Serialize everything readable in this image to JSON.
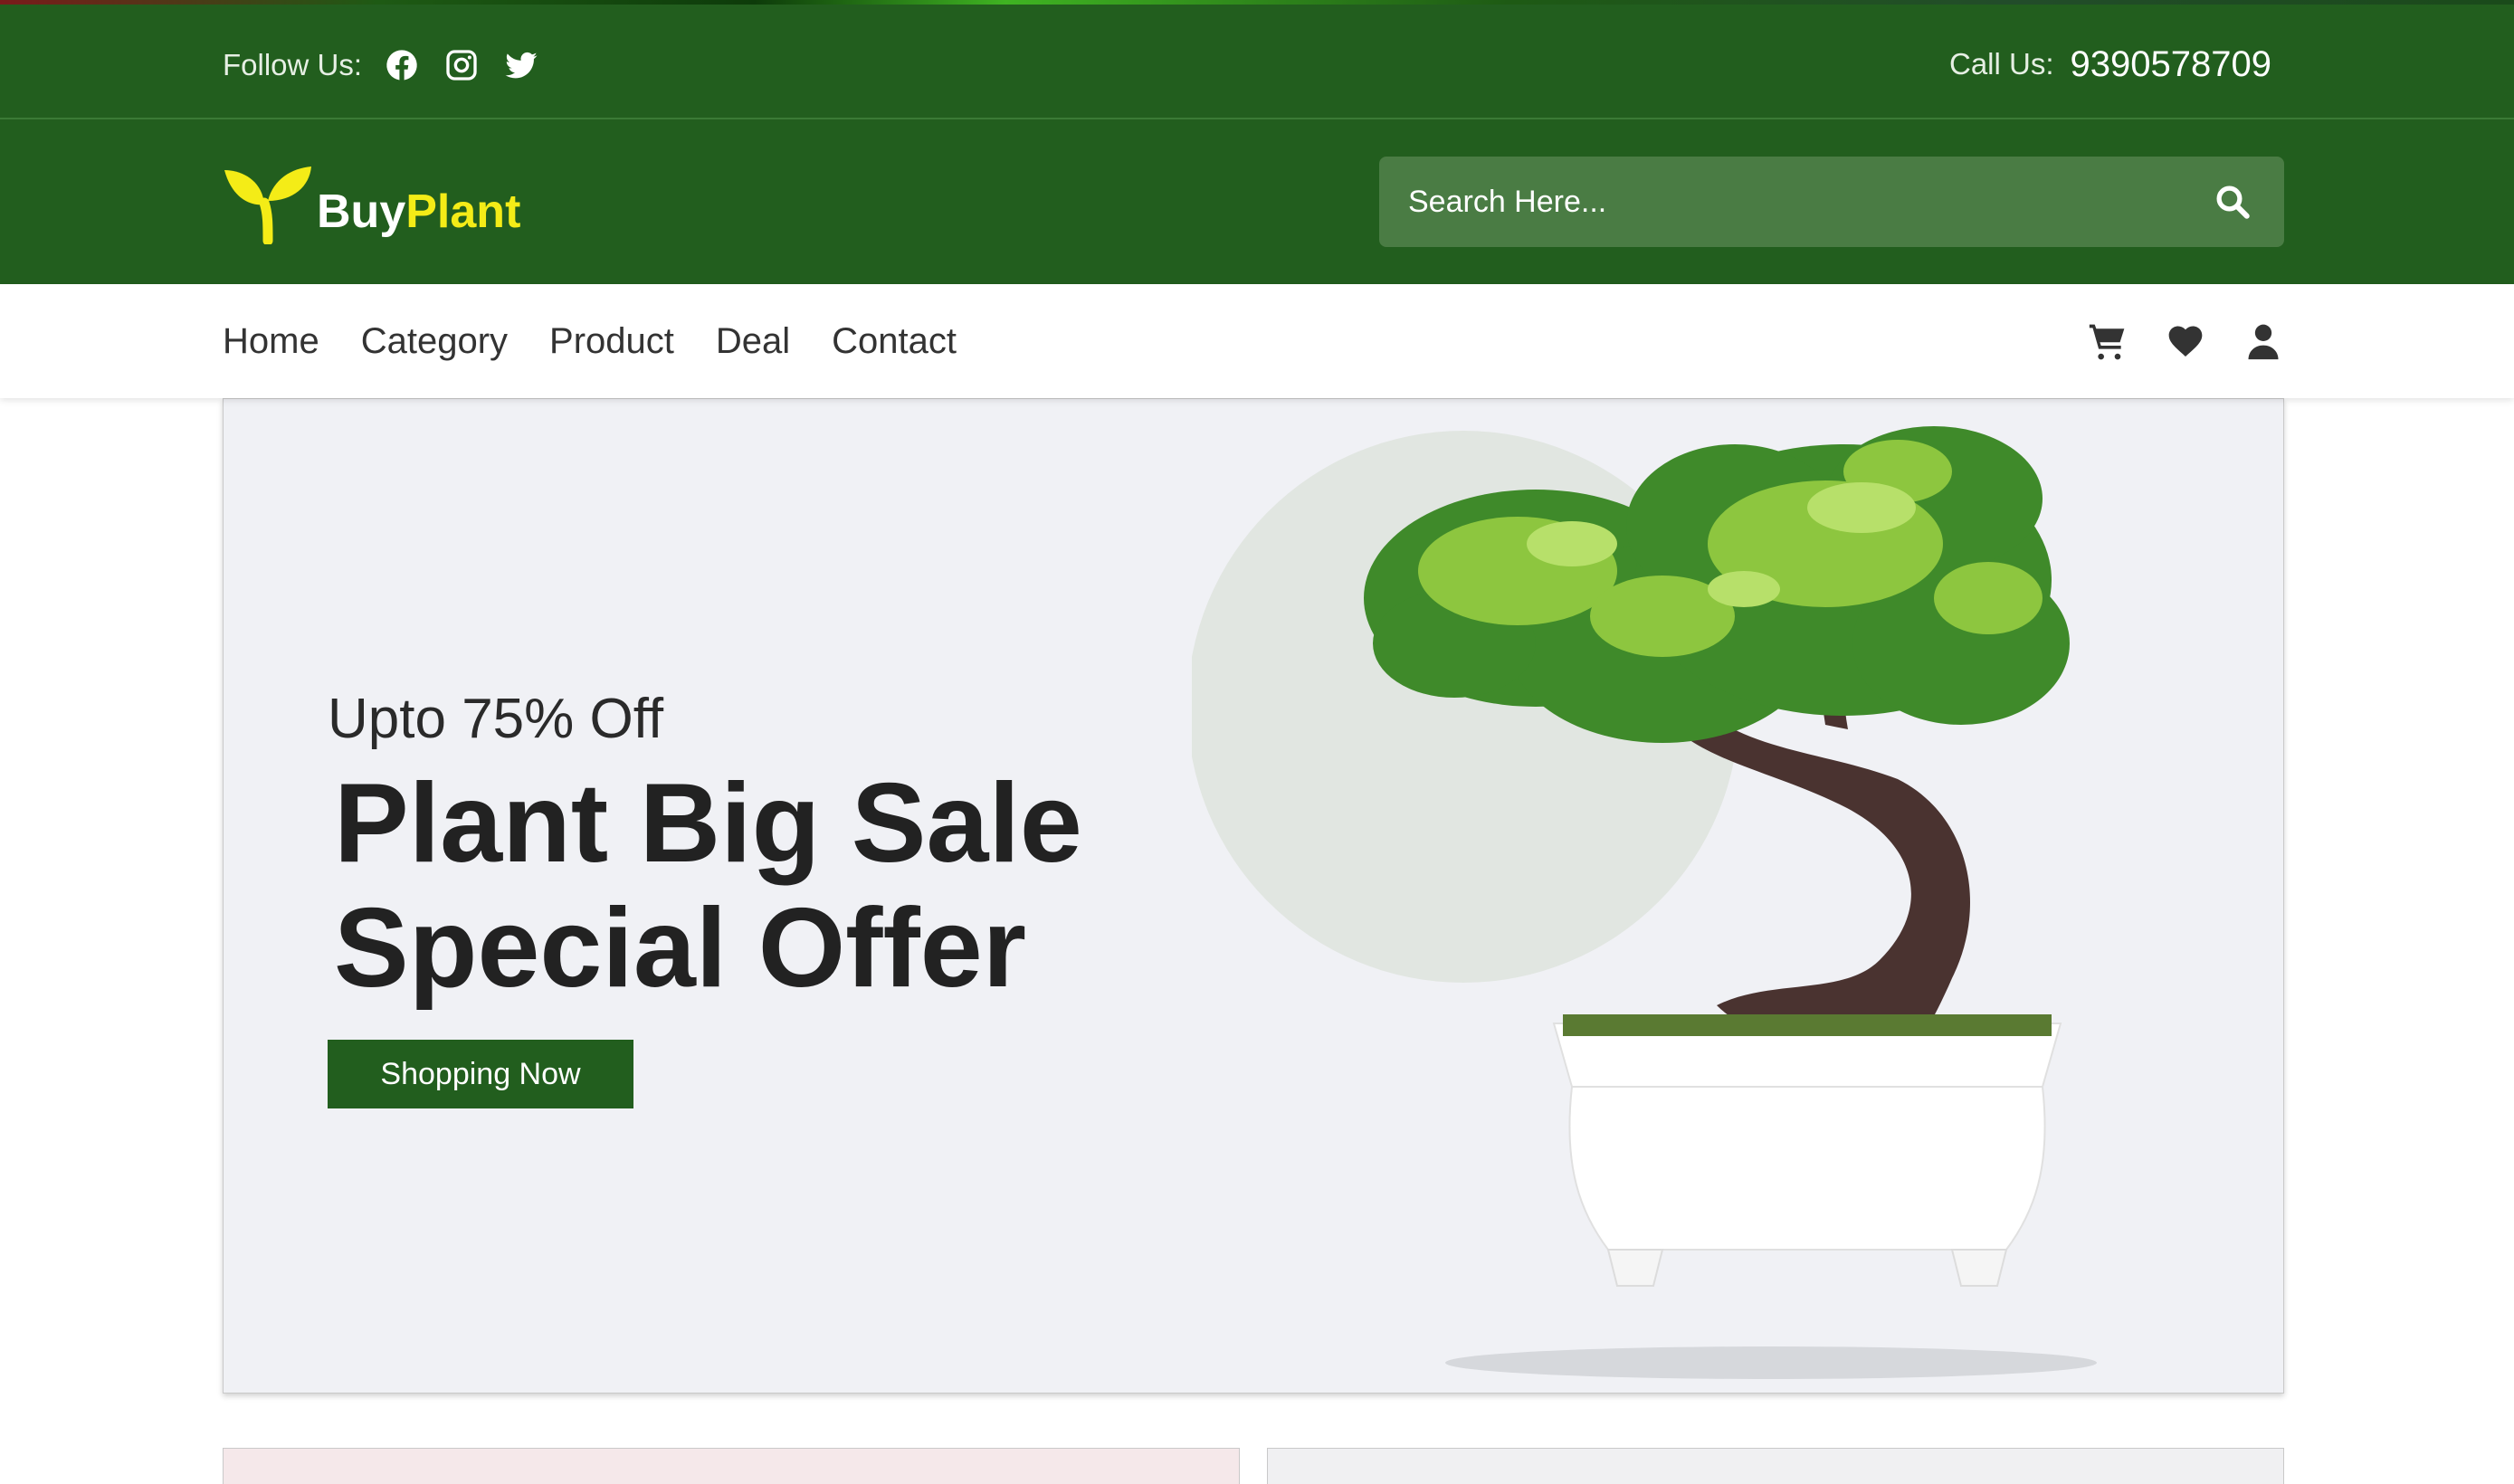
{
  "topbar": {
    "follow_label": "Follow Us:",
    "social_icons": [
      "facebook-icon",
      "instagram-icon",
      "twitter-icon"
    ],
    "call_label": "Call Us:",
    "call_number": "9390578709"
  },
  "header": {
    "logo_buy": "Buy",
    "logo_plant": "Plant",
    "search_placeholder": "Search Here..."
  },
  "nav": {
    "links": [
      {
        "label": "Home"
      },
      {
        "label": "Category"
      },
      {
        "label": "Product"
      },
      {
        "label": "Deal"
      },
      {
        "label": "Contact"
      }
    ],
    "icons": [
      "cart-icon",
      "heart-icon",
      "user-icon"
    ]
  },
  "hero": {
    "subtitle": "Upto 75% Off",
    "title_line1": "Plant Big Sale",
    "title_line2": "Special Offer",
    "button_label": "Shopping Now"
  },
  "colors": {
    "brand_green": "#225e1e",
    "search_bg": "#4a7c44",
    "logo_yellow": "#f4ec17",
    "hero_bg": "#f0f1f5"
  }
}
